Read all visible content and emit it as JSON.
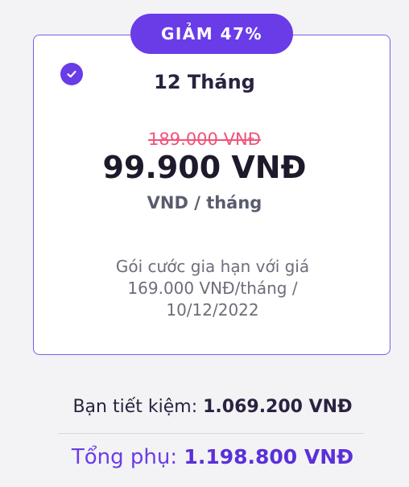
{
  "plan": {
    "discount_badge": "GIẢM 47%",
    "selected": true,
    "period": "12 Tháng",
    "original_price": "189.000 VNĐ",
    "current_price": "99.900 VNĐ",
    "unit": "VND / tháng",
    "renewal_note": "Gói cước gia hạn với giá 169.000 VNĐ/tháng / 10/12/2022"
  },
  "summary": {
    "savings_label": "Bạn tiết kiệm:",
    "savings_amount": "1.069.200 VNĐ",
    "subtotal_label": "Tổng phụ:",
    "subtotal_amount": "1.198.800 VNĐ"
  },
  "colors": {
    "accent": "#6a3ce8",
    "strikethrough": "#f0547a",
    "card_border": "#7b5cf0",
    "background": "#f3f3f5"
  },
  "icons": {
    "selected_indicator": "check-circle-icon"
  }
}
